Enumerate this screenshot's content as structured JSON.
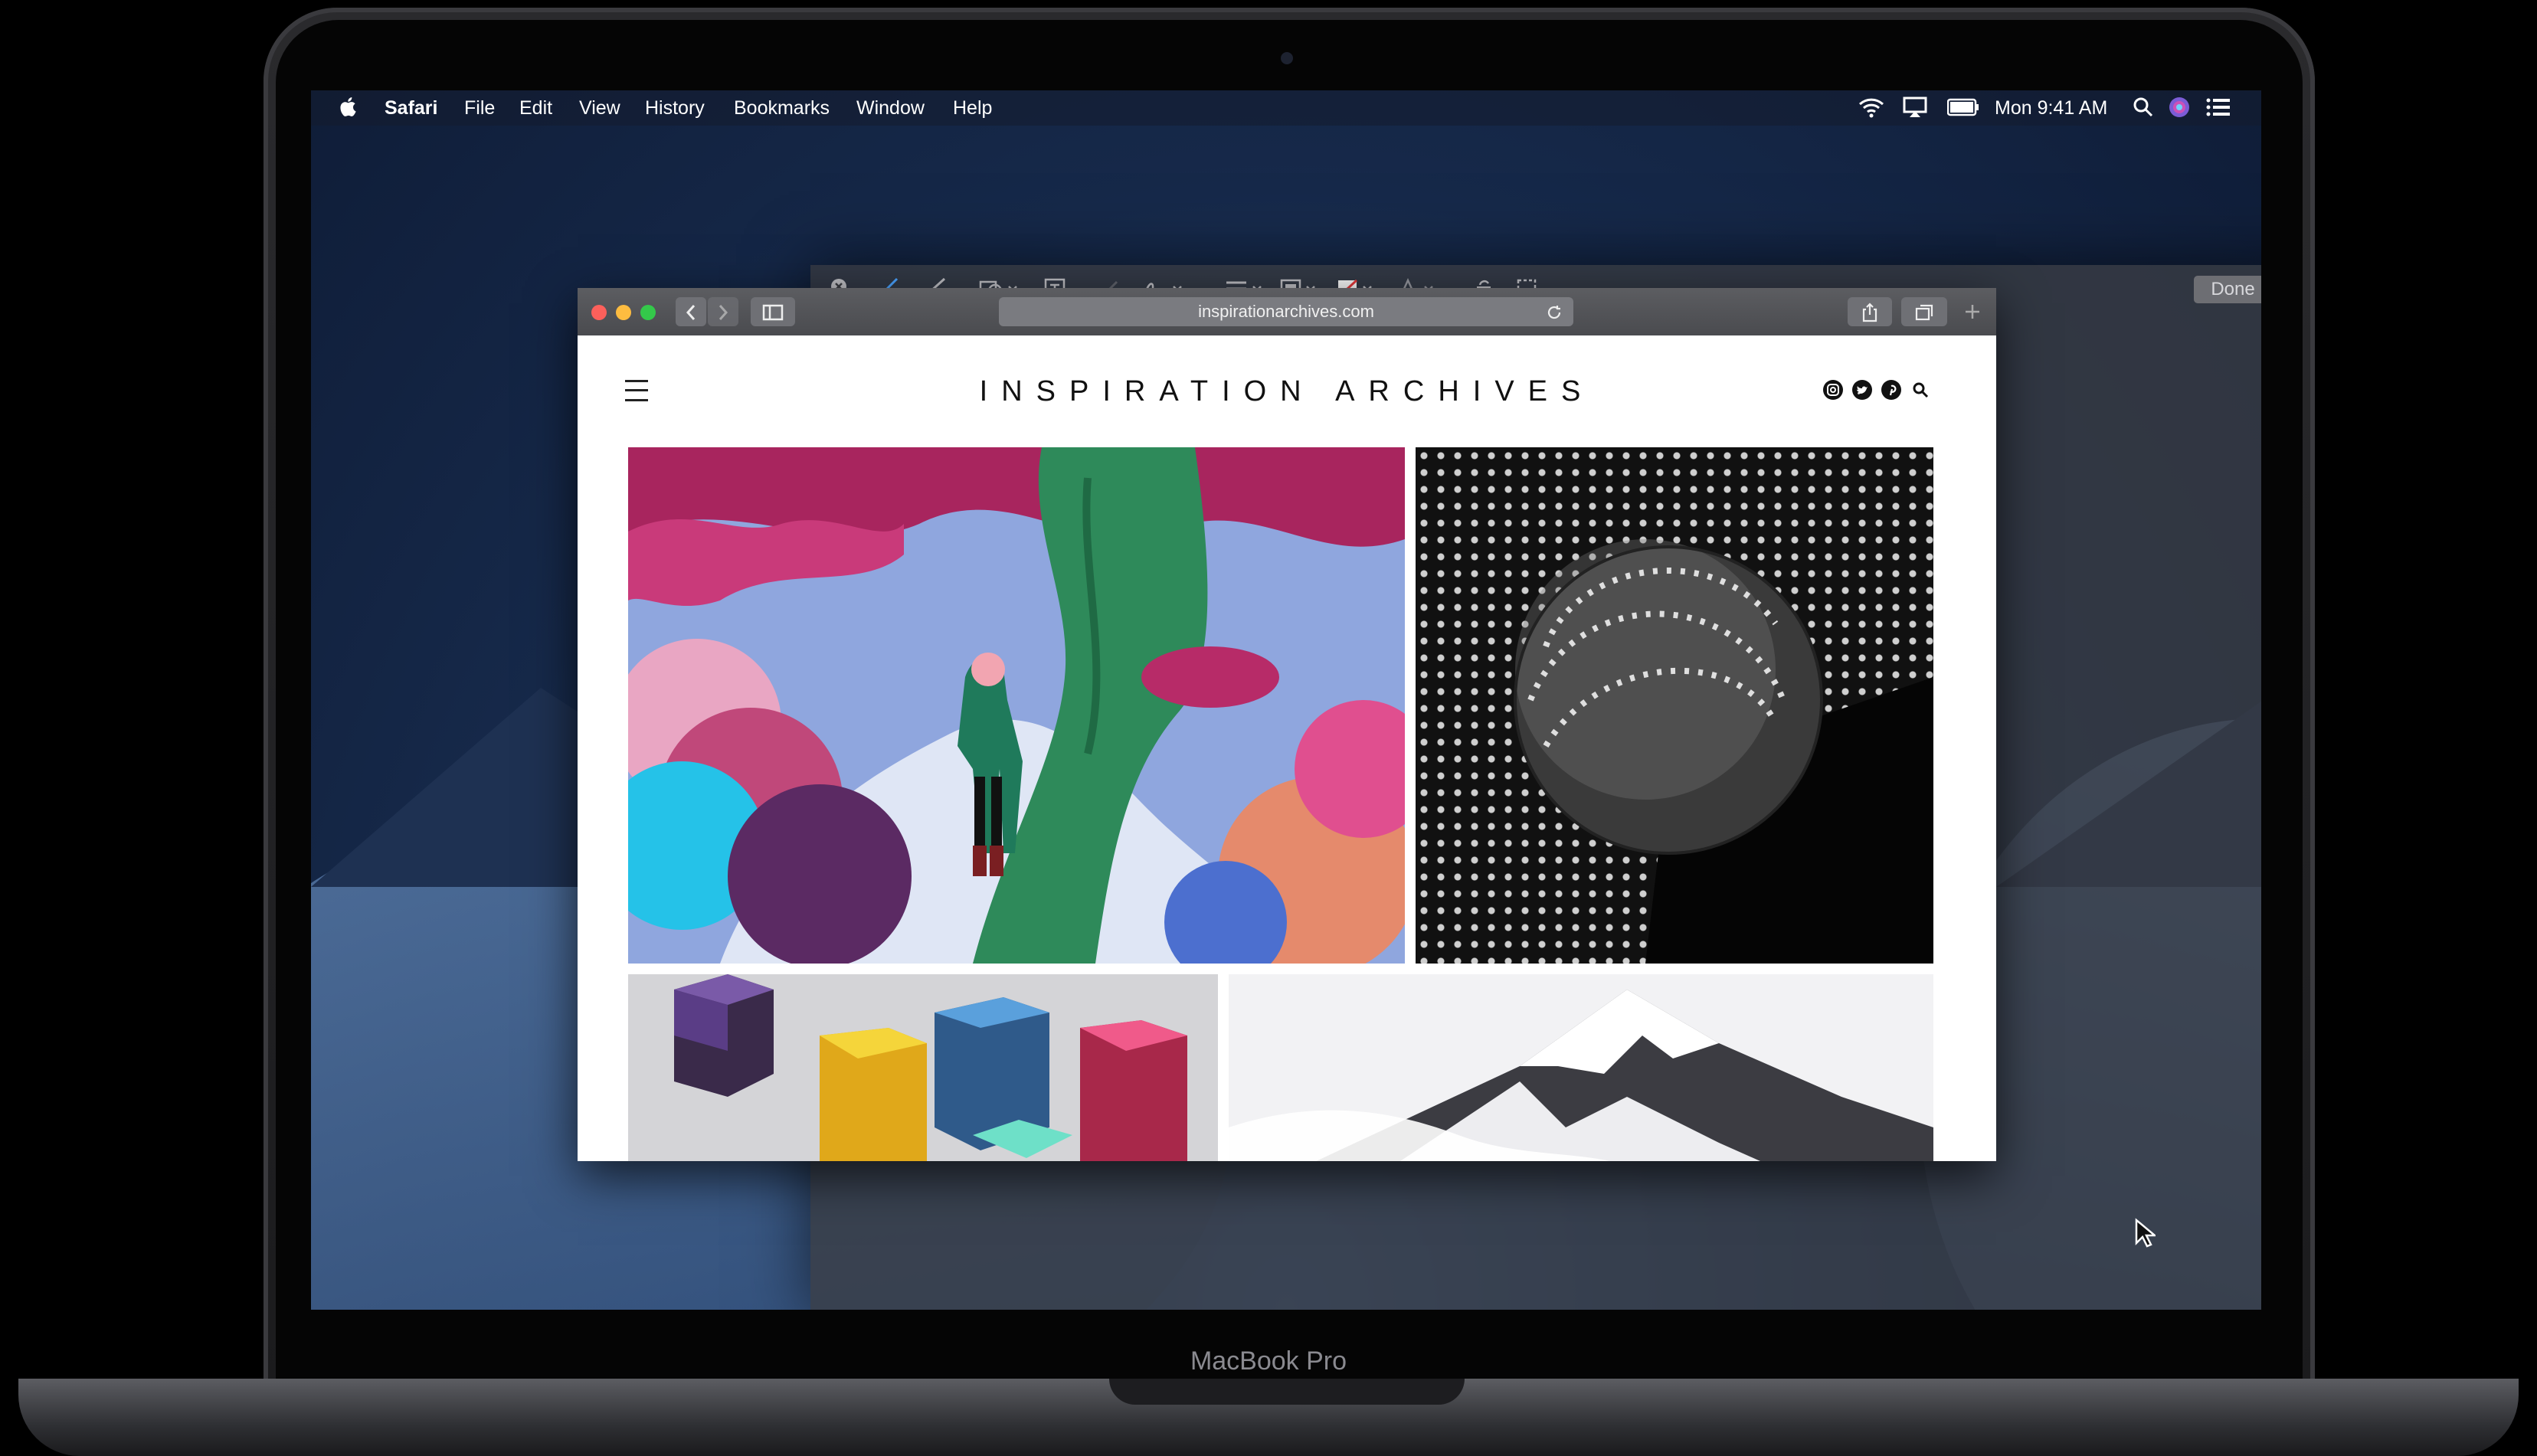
{
  "device": {
    "brand_label": "MacBook Pro"
  },
  "menubar": {
    "apple_icon": "apple-logo-icon",
    "app_name": "Safari",
    "items": [
      "File",
      "Edit",
      "View",
      "History",
      "Bookmarks",
      "Window",
      "Help"
    ],
    "clock": "Mon 9:41 AM",
    "status_icons": [
      "wifi-icon",
      "airplay-icon",
      "battery-icon",
      "spotlight-icon",
      "siri-icon",
      "notification-center-icon"
    ]
  },
  "markup_toolbar": {
    "done_label": "Done",
    "tools": [
      "close-icon",
      "sketch-icon",
      "draw-icon",
      "shapes-icon",
      "text-icon",
      "highlight-icon",
      "sign-icon",
      "line-style-icon",
      "border-color-icon",
      "fill-color-icon",
      "text-style-icon",
      "rotate-icon",
      "crop-icon"
    ],
    "trash_icon": "trash-icon",
    "share_icon": "share-icon"
  },
  "safari": {
    "url": "inspirationarchives.com",
    "reload_icon": "reload-icon",
    "share_icon": "share-icon",
    "tabs_icon": "tabs-icon",
    "new_tab_icon": "plus-icon"
  },
  "website": {
    "title": "INSPIRATION ARCHIVES",
    "menu_icon": "hamburger-icon",
    "social_icons": [
      "instagram-icon",
      "twitter-icon",
      "pinterest-icon",
      "search-icon"
    ]
  },
  "colors": {
    "menubar_text": "#ffffff",
    "traffic_red": "#fc605b",
    "traffic_yellow": "#fdbc40",
    "traffic_green": "#34c84a"
  }
}
